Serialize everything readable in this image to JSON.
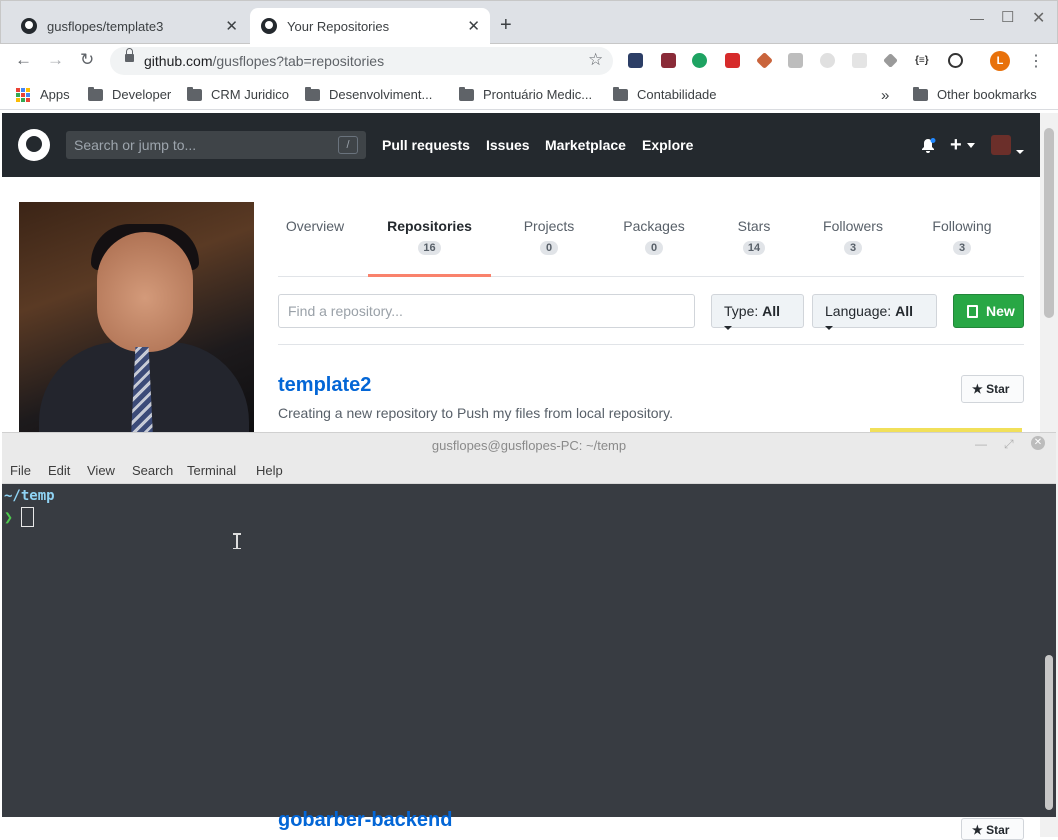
{
  "browser": {
    "tabs": [
      {
        "title": "gusflopes/template3",
        "active": false
      },
      {
        "title": "Your Repositories",
        "active": true
      }
    ],
    "new_tab_glyph": "+",
    "url_host": "github.com",
    "url_path": "/gusflopes?tab=repositories",
    "bookmarks": [
      "Apps",
      "Developer",
      "CRM Juridico",
      "Desenvolviment...",
      "Prontuário Medic...",
      "Contabilidade"
    ],
    "overflow_glyph": "»",
    "other_bookmarks": "Other bookmarks",
    "profile_initial": "L"
  },
  "github": {
    "search_placeholder": "Search or jump to...",
    "slash_key": "/",
    "nav": [
      "Pull requests",
      "Issues",
      "Marketplace",
      "Explore"
    ],
    "profile_tabs": [
      {
        "label": "Overview",
        "count": ""
      },
      {
        "label": "Repositories",
        "count": "16",
        "active": true
      },
      {
        "label": "Projects",
        "count": "0"
      },
      {
        "label": "Packages",
        "count": "0"
      },
      {
        "label": "Stars",
        "count": "14"
      },
      {
        "label": "Followers",
        "count": "3"
      },
      {
        "label": "Following",
        "count": "3"
      }
    ],
    "find_placeholder": "Find a repository...",
    "type_label": "Type:",
    "type_value": "All",
    "language_label": "Language:",
    "language_value": "All",
    "new_label": "New",
    "star_label": "Star",
    "repos": [
      {
        "name": "template2",
        "description": "Creating a new repository to Push my files from local repository."
      },
      {
        "name": "gobarber-backend",
        "description": ""
      }
    ],
    "accent_color": "#f9826c",
    "new_button_color": "#28a745",
    "link_color": "#0366d6"
  },
  "terminal": {
    "title": "gusflopes@gusflopes-PC: ~/temp",
    "menu": [
      "File",
      "Edit",
      "View",
      "Search",
      "Terminal",
      "Help"
    ],
    "cwd": "~/temp",
    "prompt_glyph": "❯"
  }
}
